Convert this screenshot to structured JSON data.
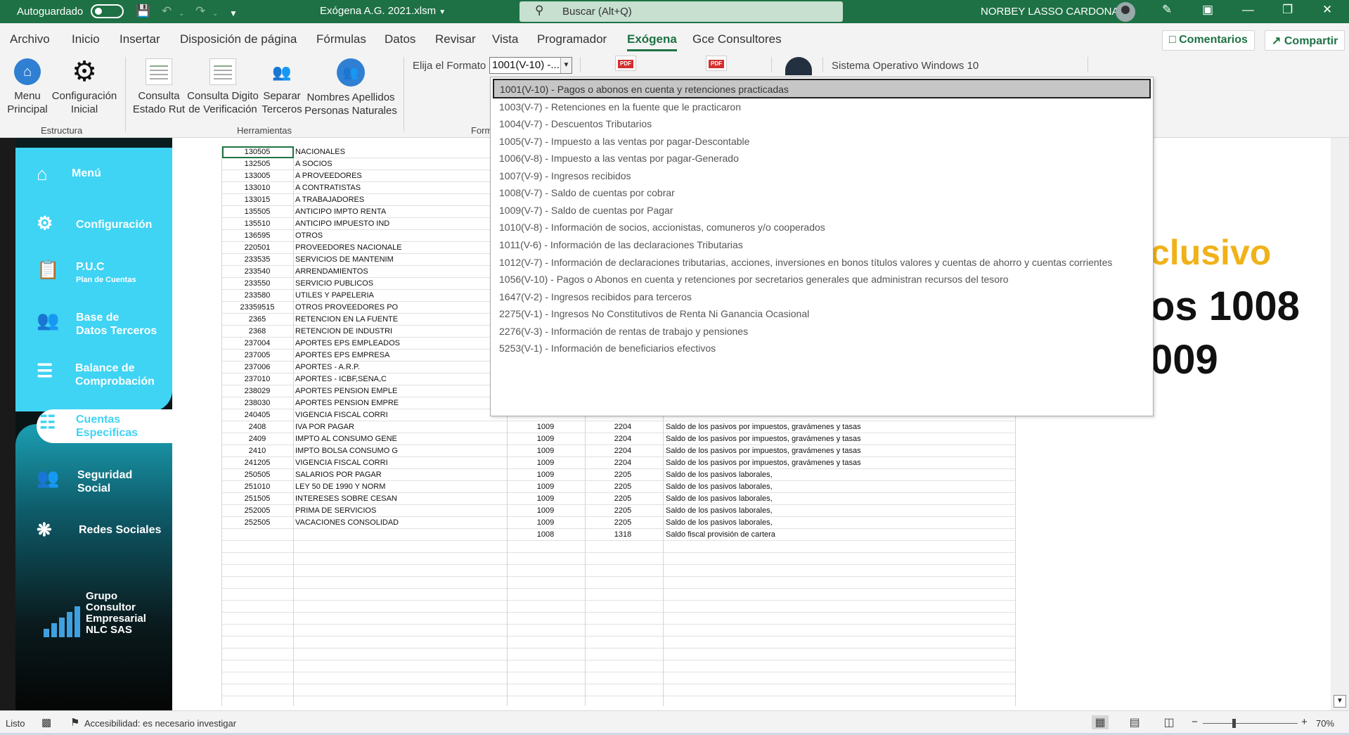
{
  "titlebar": {
    "autosave_label": "Autoguardado",
    "file_name": "Exógena A.G. 2021.xlsm",
    "search_placeholder": "Buscar (Alt+Q)",
    "user_name": "NORBEY LASSO CARDONA"
  },
  "menu": {
    "tabs": [
      "Archivo",
      "Inicio",
      "Insertar",
      "Disposición de página",
      "Fórmulas",
      "Datos",
      "Revisar",
      "Vista",
      "Programador",
      "Exógena",
      "Gce Consultores"
    ],
    "active_tab": "Exógena",
    "comments_label": "Comentarios",
    "share_label": "Compartir"
  },
  "ribbon": {
    "menu_principal": "Menu Principal",
    "config_inicial": "Configuración Inicial",
    "group_estructura": "Estructura",
    "consulta_rut": "Consulta Estado Rut",
    "consulta_digito": "Consulta Digito de Verificación",
    "separar_terceros": "Separar Terceros",
    "nombres_apellidos": "Nombres Apellidos Personas Naturales",
    "group_herramientas": "Herramientas",
    "group_formato": "Form",
    "format_label": "Elija el Formato",
    "format_value": "1001(V-10) -...",
    "os_label": "Sistema Operativo Windows 10"
  },
  "sidebar": {
    "items": [
      {
        "label": "Menú",
        "icon": "home-icon"
      },
      {
        "label": "Configuración",
        "icon": "head-gear-icon"
      },
      {
        "label": "P.U.C",
        "sub": "Plan de Cuentas",
        "icon": "clipboard-icon"
      },
      {
        "label": "Base de",
        "label2": "Datos Terceros",
        "icon": "people-group-icon"
      },
      {
        "label": "Balance de",
        "label2": "Comprobación",
        "icon": "stack-icon"
      },
      {
        "label": "Cuentas",
        "label2": "Especificas",
        "icon": "hierarchy-icon"
      },
      {
        "label": "Seguridad",
        "label2": "Social",
        "icon": "users-icon"
      },
      {
        "label": "Redes Sociales",
        "icon": "network-icon"
      }
    ],
    "brand": [
      "Grupo",
      "Consultor",
      "Empresarial",
      "NLC SAS"
    ]
  },
  "sheet_rows": [
    {
      "a": "130505",
      "b": "NACIONALES",
      "c": "",
      "d": "",
      "e": ""
    },
    {
      "a": "132505",
      "b": "A SOCIOS",
      "c": "",
      "d": "",
      "e": ""
    },
    {
      "a": "133005",
      "b": "A PROVEEDORES",
      "c": "",
      "d": "",
      "e": ""
    },
    {
      "a": "133010",
      "b": "A CONTRATISTAS",
      "c": "",
      "d": "",
      "e": ""
    },
    {
      "a": "133015",
      "b": "A TRABAJADORES",
      "c": "",
      "d": "",
      "e": ""
    },
    {
      "a": "135505",
      "b": "ANTICIPO IMPTO RENTA",
      "c": "",
      "d": "",
      "e": ""
    },
    {
      "a": "135510",
      "b": "ANTICIPO IMPUESTO IND",
      "c": "",
      "d": "",
      "e": ""
    },
    {
      "a": "136595",
      "b": "OTROS",
      "c": "",
      "d": "",
      "e": ""
    },
    {
      "a": "220501",
      "b": "PROVEEDORES NACIONALE",
      "c": "",
      "d": "",
      "e": ""
    },
    {
      "a": "233535",
      "b": "SERVICIOS DE MANTENIM",
      "c": "",
      "d": "",
      "e": ""
    },
    {
      "a": "233540",
      "b": "ARRENDAMIENTOS",
      "c": "",
      "d": "",
      "e": ""
    },
    {
      "a": "233550",
      "b": "SERVICIO PUBLICOS",
      "c": "",
      "d": "",
      "e": ""
    },
    {
      "a": "233580",
      "b": "UTILES Y PAPELERIA",
      "c": "",
      "d": "",
      "e": ""
    },
    {
      "a": "23359515",
      "b": "OTROS PROVEEDORES PO",
      "c": "",
      "d": "",
      "e": ""
    },
    {
      "a": "2365",
      "b": "RETENCION EN LA FUENTE",
      "c": "",
      "d": "",
      "e": ""
    },
    {
      "a": "2368",
      "b": "RETENCION DE INDUSTRI",
      "c": "",
      "d": "",
      "e": ""
    },
    {
      "a": "237004",
      "b": "APORTES EPS EMPLEADOS",
      "c": "",
      "d": "",
      "e": ""
    },
    {
      "a": "237005",
      "b": "APORTES EPS EMPRESA",
      "c": "",
      "d": "",
      "e": ""
    },
    {
      "a": "237006",
      "b": "APORTES - A.R.P.",
      "c": "",
      "d": "",
      "e": ""
    },
    {
      "a": "237010",
      "b": "APORTES - ICBF,SENA,C",
      "c": "",
      "d": "",
      "e": ""
    },
    {
      "a": "238029",
      "b": "APORTES PENSION EMPLE",
      "c": "",
      "d": "",
      "e": ""
    },
    {
      "a": "238030",
      "b": "APORTES PENSION EMPRE",
      "c": "",
      "d": "",
      "e": ""
    },
    {
      "a": "240405",
      "b": "VIGENCIA FISCAL CORRI",
      "c": "",
      "d": "",
      "e": ""
    },
    {
      "a": "2408",
      "b": "IVA POR PAGAR",
      "c": "1009",
      "d": "2204",
      "e": "Saldo de los pasivos por impuestos, gravámenes y tasas"
    },
    {
      "a": "2409",
      "b": "IMPTO AL CONSUMO GENE",
      "c": "1009",
      "d": "2204",
      "e": "Saldo de los pasivos por impuestos, gravámenes y tasas"
    },
    {
      "a": "2410",
      "b": "IMPTO BOLSA CONSUMO G",
      "c": "1009",
      "d": "2204",
      "e": "Saldo de los pasivos por impuestos, gravámenes y tasas"
    },
    {
      "a": "241205",
      "b": "VIGENCIA FISCAL CORRI",
      "c": "1009",
      "d": "2204",
      "e": "Saldo de los pasivos por impuestos, gravámenes y tasas"
    },
    {
      "a": "250505",
      "b": "SALARIOS POR PAGAR",
      "c": "1009",
      "d": "2205",
      "e": "Saldo de los pasivos laborales,"
    },
    {
      "a": "251010",
      "b": "LEY 50 DE 1990 Y NORM",
      "c": "1009",
      "d": "2205",
      "e": "Saldo de los pasivos laborales,"
    },
    {
      "a": "251505",
      "b": "INTERESES SOBRE CESAN",
      "c": "1009",
      "d": "2205",
      "e": "Saldo de los pasivos laborales,"
    },
    {
      "a": "252005",
      "b": "PRIMA DE SERVICIOS",
      "c": "1009",
      "d": "2205",
      "e": "Saldo de los pasivos laborales,"
    },
    {
      "a": "252505",
      "b": "VACACIONES CONSOLIDAD",
      "c": "1009",
      "d": "2205",
      "e": "Saldo de los pasivos laborales,"
    },
    {
      "a": "",
      "b": "",
      "c": "1008",
      "d": "1318",
      "e": "Saldo fiscal provisión de cartera"
    }
  ],
  "background_text": {
    "line1": "clusivo",
    "line2": "os 1008",
    "line3": "009"
  },
  "dropdown": {
    "options": [
      "1001(V-10) - Pagos o abonos en cuenta y retenciones practicadas",
      "1003(V-7) - Retenciones en la fuente que le practicaron",
      "1004(V-7) - Descuentos Tributarios",
      "1005(V-7) - Impuesto a las ventas por pagar-Descontable",
      "1006(V-8) - Impuesto a las ventas por pagar-Generado",
      "1007(V-9) - Ingresos recibidos",
      "1008(V-7) - Saldo de cuentas por cobrar",
      "1009(V-7) - Saldo de cuentas por Pagar",
      "1010(V-8) - Información de socios,  accionistas, comuneros y/o cooperados",
      "1011(V-6) - Información de las declaraciones Tributarias",
      "1012(V-7) - Información de declaraciones tributarias, acciones, inversiones en bonos títulos valores y cuentas de ahorro y cuentas corrientes",
      "1056(V-10) - Pagos o Abonos en cuenta y retenciones por secretarios generales que administran recursos del tesoro",
      "1647(V-2) - Ingresos recibidos para terceros",
      "2275(V-1) - Ingresos No Constitutivos de Renta Ni Ganancia Ocasional",
      "2276(V-3) - Información de rentas de trabajo y pensiones",
      "5253(V-1) - Información de beneficiarios efectivos"
    ],
    "selected_index": 0
  },
  "status": {
    "ready": "Listo",
    "accessibility": "Accesibilidad: es necesario investigar",
    "zoom": "70%"
  }
}
